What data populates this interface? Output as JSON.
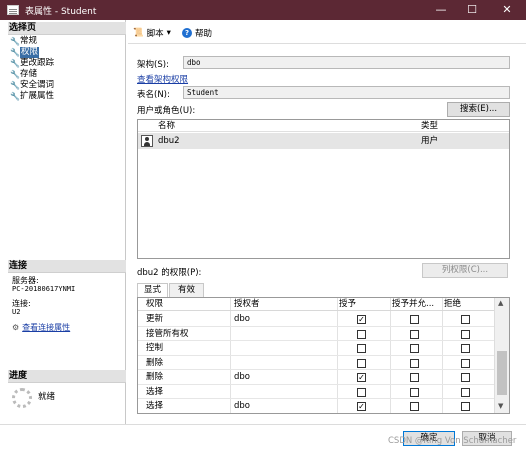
{
  "window": {
    "title": "表属性 - Student"
  },
  "left": {
    "select_page_header": "选择页",
    "pages": [
      "常规",
      "权限",
      "更改跟踪",
      "存储",
      "安全谓词",
      "扩展属性"
    ],
    "connection_header": "连接",
    "server_label": "服务器:",
    "server_value": "PC-20180617YNMI",
    "connection_label": "连接:",
    "connection_value": "U2",
    "view_conn_props": "查看连接属性",
    "progress_header": "进度",
    "progress_status": "就绪"
  },
  "toolbar": {
    "script_label": "脚本",
    "help_label": "帮助"
  },
  "main": {
    "schema_label": "架构(S):",
    "schema_value": "dbo",
    "view_schema_perm": "查看架构权限",
    "table_name_label": "表名(N):",
    "table_name_value": "Student",
    "users_label": "用户或角色(U):",
    "search_button": "搜索(E)...",
    "users_list": {
      "col_name": "名称",
      "col_type": "类型",
      "rows": [
        {
          "name": "dbu2",
          "type": "用户"
        }
      ]
    },
    "perm_for_label": "dbu2 的权限(P):",
    "column_perm_button": "列权限(C)...",
    "tabs": [
      "显式",
      "有效"
    ],
    "perm_grid": {
      "headers": [
        "权限",
        "授权者",
        "授予",
        "授予并允...",
        "拒绝"
      ],
      "rows": [
        {
          "perm": "更新",
          "grantor": "dbo",
          "grant": true,
          "with_grant": false,
          "deny": false
        },
        {
          "perm": "接管所有权",
          "grantor": "",
          "grant": false,
          "with_grant": false,
          "deny": false
        },
        {
          "perm": "控制",
          "grantor": "",
          "grant": false,
          "with_grant": false,
          "deny": false
        },
        {
          "perm": "删除",
          "grantor": "",
          "grant": false,
          "with_grant": false,
          "deny": false
        },
        {
          "perm": "删除",
          "grantor": "dbo",
          "grant": true,
          "with_grant": false,
          "deny": false
        },
        {
          "perm": "选择",
          "grantor": "",
          "grant": false,
          "with_grant": false,
          "deny": false
        },
        {
          "perm": "选择",
          "grantor": "dbo",
          "grant": true,
          "with_grant": false,
          "deny": false
        }
      ]
    }
  },
  "footer": {
    "ok_button": "确定",
    "cancel_button": "取消",
    "watermark": "CSDN @King Von Schumacher"
  }
}
